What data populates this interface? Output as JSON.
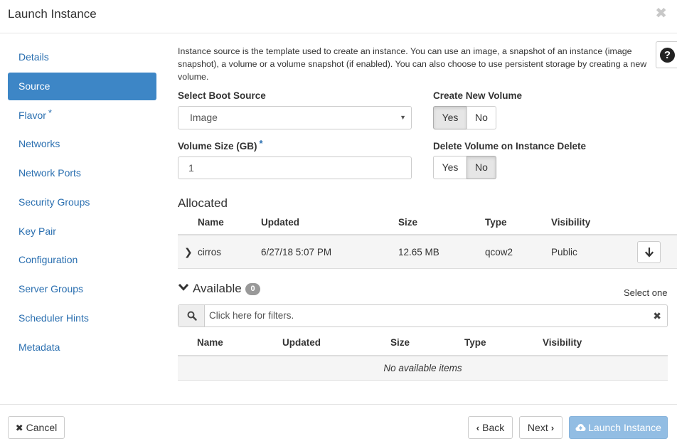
{
  "header": {
    "title": "Launch Instance",
    "close_glyph": "✖"
  },
  "nav": {
    "items": [
      {
        "label": "Details",
        "required": false,
        "active": false
      },
      {
        "label": "Source",
        "required": false,
        "active": true
      },
      {
        "label": "Flavor",
        "required": true,
        "active": false
      },
      {
        "label": "Networks",
        "required": false,
        "active": false
      },
      {
        "label": "Network Ports",
        "required": false,
        "active": false
      },
      {
        "label": "Security Groups",
        "required": false,
        "active": false
      },
      {
        "label": "Key Pair",
        "required": false,
        "active": false
      },
      {
        "label": "Configuration",
        "required": false,
        "active": false
      },
      {
        "label": "Server Groups",
        "required": false,
        "active": false
      },
      {
        "label": "Scheduler Hints",
        "required": false,
        "active": false
      },
      {
        "label": "Metadata",
        "required": false,
        "active": false
      }
    ],
    "required_marker": "*"
  },
  "help": {
    "glyph": "?"
  },
  "intro_text": "Instance source is the template used to create an instance. You can use an image, a snapshot of an instance (image snapshot), a volume or a volume snapshot (if enabled). You can also choose to use persistent storage by creating a new volume.",
  "form": {
    "boot_source_label": "Select Boot Source",
    "boot_source_value": "Image",
    "caret": "▼",
    "create_volume_label": "Create New Volume",
    "create_volume": {
      "yes": "Yes",
      "no": "No",
      "selected": "Yes"
    },
    "volume_size_label": "Volume Size (GB)",
    "volume_size_required": "*",
    "volume_size_value": "1",
    "delete_volume_label": "Delete Volume on Instance Delete",
    "delete_volume": {
      "yes": "Yes",
      "no": "No",
      "selected": "No"
    }
  },
  "allocated": {
    "title": "Allocated",
    "columns": [
      "Name",
      "Updated",
      "Size",
      "Type",
      "Visibility"
    ],
    "rows": [
      {
        "name": "cirros",
        "updated": "6/27/18 5:07 PM",
        "size": "12.65 MB",
        "type": "qcow2",
        "visibility": "Public"
      }
    ],
    "expander_glyph": "❯",
    "move_down_glyph": "🡓"
  },
  "available": {
    "title": "Available",
    "count": "0",
    "chevron_glyph": "❯",
    "select_hint": "Select one",
    "filter_placeholder": "Click here for filters.",
    "clear_glyph": "✖",
    "columns": [
      "Name",
      "Updated",
      "Size",
      "Type",
      "Visibility"
    ],
    "empty_text": "No available items"
  },
  "footer": {
    "cancel": "Cancel",
    "cancel_glyph": "✖",
    "back": "Back",
    "back_glyph": "‹",
    "next": "Next",
    "next_glyph": "›",
    "launch": "Launch Instance"
  },
  "colors": {
    "accent": "#3d86c6",
    "link": "#2a6fb0",
    "primary_disabled": "#92bde3"
  }
}
